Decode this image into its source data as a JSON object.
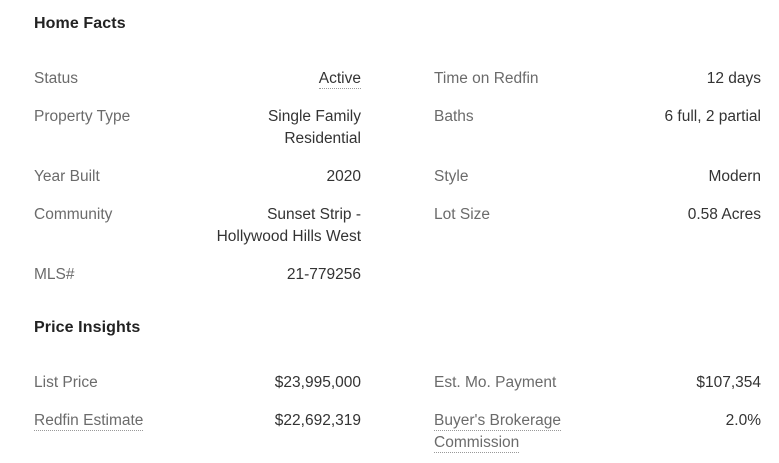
{
  "home_facts": {
    "title": "Home Facts",
    "left": [
      {
        "label": "Status",
        "value": "Active"
      },
      {
        "label": "Property Type",
        "value_line1": "Single Family",
        "value_line2": "Residential"
      },
      {
        "label": "Year Built",
        "value": "2020"
      },
      {
        "label": "Community",
        "value_line1": "Sunset Strip -",
        "value_line2": "Hollywood Hills West"
      },
      {
        "label": "MLS#",
        "value": "21-779256"
      }
    ],
    "right": [
      {
        "label": "Time on Redfin",
        "value": "12 days"
      },
      {
        "label": "Baths",
        "value": "6 full, 2 partial"
      },
      {
        "label": "Style",
        "value": "Modern"
      },
      {
        "label": "Lot Size",
        "value": "0.58 Acres"
      }
    ]
  },
  "price_insights": {
    "title": "Price Insights",
    "left": [
      {
        "label": "List Price",
        "value": "$23,995,000"
      },
      {
        "label": "Redfin Estimate",
        "value": "$22,692,319"
      }
    ],
    "right": [
      {
        "label": "Est. Mo. Payment",
        "value": "$107,354"
      },
      {
        "label_line1": "Buyer's Brokerage",
        "label_line2": "Commission",
        "value": "2.0%"
      }
    ]
  }
}
